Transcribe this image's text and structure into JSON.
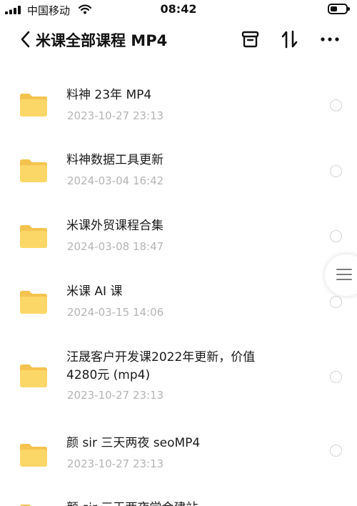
{
  "status_bar": {
    "carrier": "中国移动",
    "time": "08:42",
    "battery_level": 0.45
  },
  "nav": {
    "title": "米课全部课程 MP4",
    "icons": [
      "chevron-left-icon",
      "archive-icon",
      "sort-icon",
      "more-icon"
    ]
  },
  "files": [
    {
      "name": "料神 23年 MP4",
      "date": "2023-10-27 23:13"
    },
    {
      "name": "料神数据工具更新",
      "date": "2024-03-04 16:42"
    },
    {
      "name": "米课外贸课程合集",
      "date": "2024-03-08 18:47"
    },
    {
      "name": "米课 AI 课",
      "date": "2024-03-15 14:06"
    },
    {
      "name_line1": "汪晟客户开发课2022年更新，价值",
      "name_line2": "4280元 (mp4)",
      "date": "2023-10-27 23:13"
    },
    {
      "name": "颜 sir 三天两夜 seoMP4",
      "date": "2023-10-27 23:13"
    },
    {
      "name": "颜 sir 三天两夜学会建站"
    }
  ],
  "colors": {
    "folder": "#fbd767",
    "folder_tab": "#f4c34f",
    "date_text": "#b4b4b4"
  }
}
